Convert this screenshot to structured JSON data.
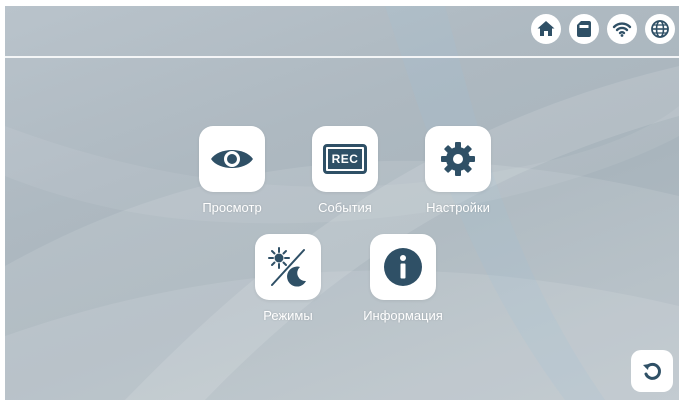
{
  "status_bar": {
    "icons": [
      "home-icon",
      "sd-card-icon",
      "wifi-icon",
      "globe-icon"
    ]
  },
  "menu": {
    "view": {
      "label": "Просмотр",
      "icon": "eye-icon"
    },
    "events": {
      "label": "События",
      "icon": "rec-icon",
      "icon_text": "REC"
    },
    "settings": {
      "label": "Настройки",
      "icon": "gear-icon"
    },
    "modes": {
      "label": "Режимы",
      "icon": "day-night-icon"
    },
    "info": {
      "label": "Информация",
      "icon": "info-icon"
    }
  },
  "colors": {
    "accent": "#2f5066",
    "background": "#afbac2",
    "tile": "#ffffff",
    "label": "#ffffff"
  }
}
